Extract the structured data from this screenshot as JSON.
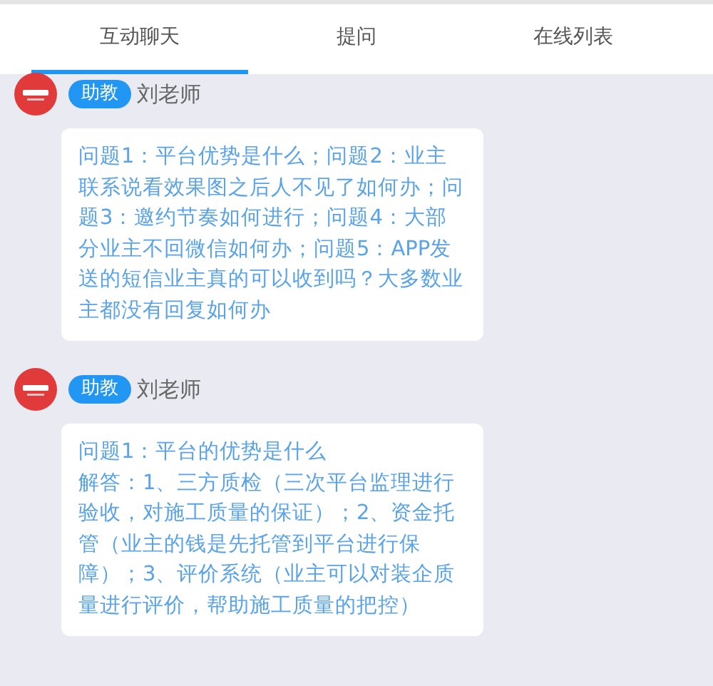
{
  "tabs": [
    {
      "label": "互动聊天",
      "selected": true
    },
    {
      "label": "提问",
      "selected": false
    },
    {
      "label": "在线列表",
      "selected": false
    }
  ],
  "messages": [
    {
      "role_badge": "助教",
      "sender": "刘老师",
      "paragraphs": [
        "问题1：平台优势是什么；问题2：业主联系说看效果图之后人不见了如何办；问题3：邀约节奏如何进行；问题4：大部分业主不回微信如何办；问题5：APP发送的短信业主真的可以收到吗？大多数业主都没有回复如何办"
      ]
    },
    {
      "role_badge": "助教",
      "sender": "刘老师",
      "paragraphs": [
        "问题1：平台的优势是什么",
        "解答：1、三方质检（三次平台监理进行验收，对施工质量的保证）；2、资金托管（业主的钱是先托管到平台进行保障）；3、评价系统（业主可以对装企质量进行评价，帮助施工质量的把控）"
      ]
    }
  ]
}
